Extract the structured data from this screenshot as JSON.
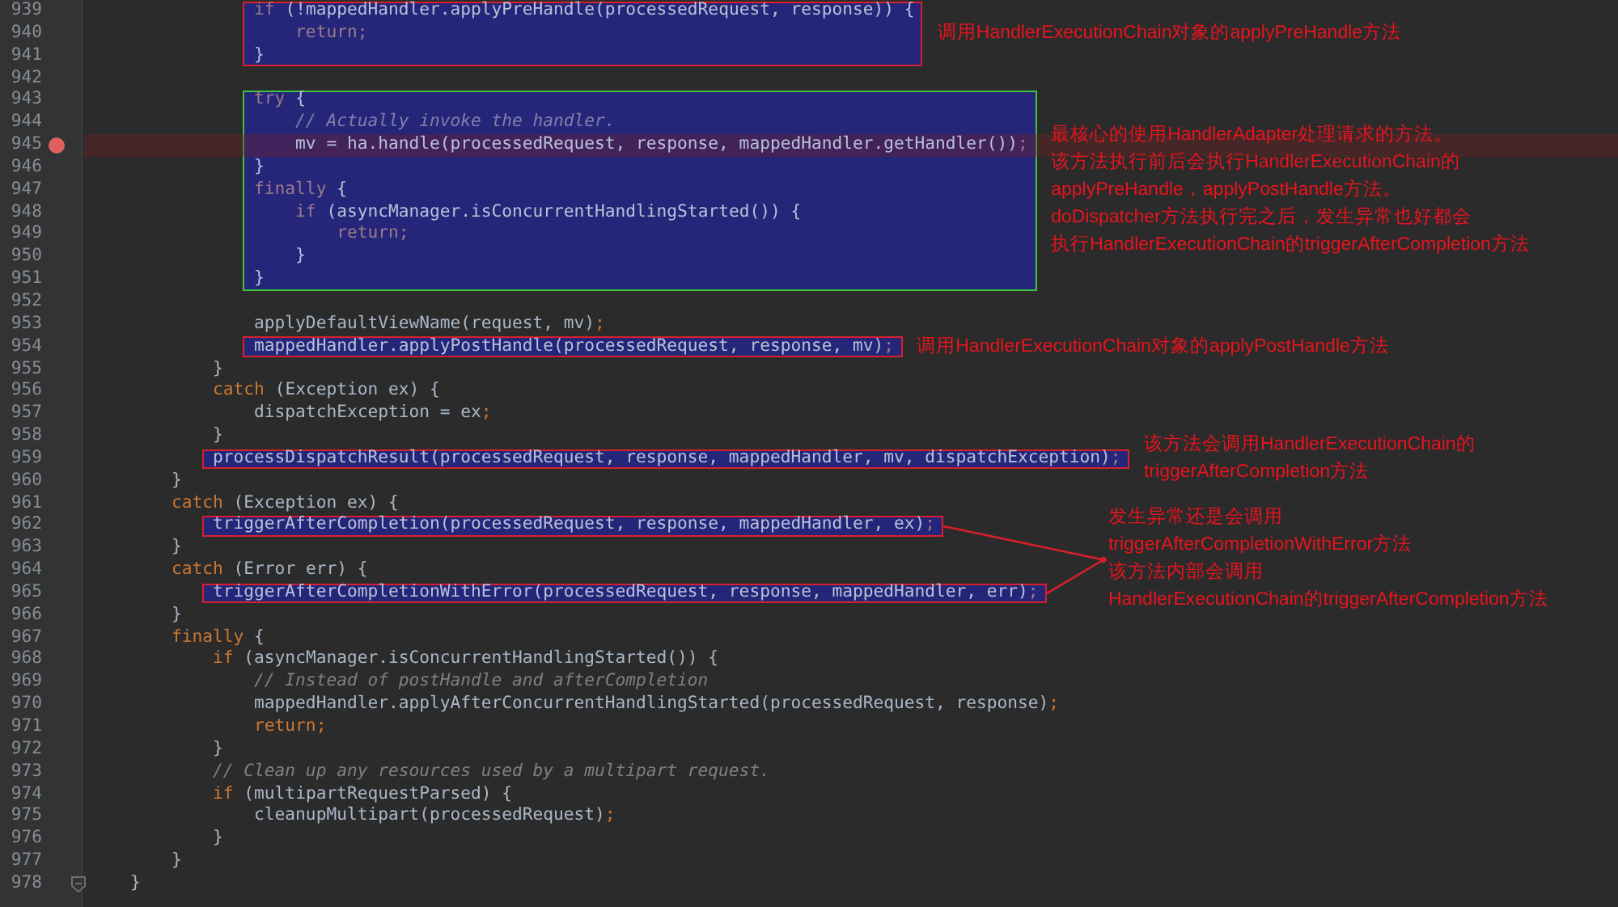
{
  "editor": {
    "segments": [
      {
        "kind": "highlight",
        "color": "#d8202c",
        "note": [
          "调用HandlerExecutionChain对象的applyPreHandle方法"
        ],
        "lines": [
          {
            "number": "939",
            "breakpoint": false,
            "fold": false,
            "tokens": [
              {
                "kind": "keyword",
                "text": "                if"
              },
              {
                "kind": "plain",
                "text": " (!mappedHandler.applyPreHandle(processedRequest, response)) {"
              }
            ]
          },
          {
            "number": "940",
            "breakpoint": false,
            "fold": false,
            "tokens": [
              {
                "kind": "keyword",
                "text": "                    return"
              },
              {
                "kind": "punct",
                "text": ";"
              }
            ]
          },
          {
            "number": "941",
            "breakpoint": false,
            "fold": false,
            "tokens": [
              {
                "kind": "plain",
                "text": "                }"
              }
            ]
          }
        ]
      },
      {
        "kind": "plain",
        "lines": [
          {
            "number": "942",
            "breakpoint": false,
            "fold": false
          }
        ]
      },
      {
        "kind": "highlight",
        "color": "#3cc43c",
        "note": [
          "最核心的使用HandlerAdapter处理请求的方法。",
          "该方法执行前后会执行HandlerExecutionChain的",
          "applyPreHandle，applyPostHandle方法。",
          "doDispatcher方法执行完之后，发生异常也好都会",
          "执行HandlerExecutionChain的triggerAfterCompletion方法"
        ],
        "lines": [
          {
            "number": "943",
            "breakpoint": false,
            "fold": false,
            "tokens": [
              {
                "kind": "keyword",
                "text": "                try"
              },
              {
                "kind": "plain",
                "text": " {"
              }
            ]
          },
          {
            "number": "944",
            "breakpoint": false,
            "fold": false,
            "tokens": [
              {
                "kind": "comment",
                "text": "                    // Actually invoke the handler."
              }
            ]
          },
          {
            "number": "945",
            "breakpoint": true,
            "fold": false,
            "tokens": [
              {
                "kind": "plain",
                "text": "                    mv = ha.handle(processedRequest, response, mappedHandler.getHandler())"
              },
              {
                "kind": "punct",
                "text": ";"
              }
            ]
          },
          {
            "number": "946",
            "breakpoint": false,
            "fold": false,
            "tokens": [
              {
                "kind": "plain",
                "text": "                }"
              }
            ]
          },
          {
            "number": "947",
            "breakpoint": false,
            "fold": false,
            "tokens": [
              {
                "kind": "keyword",
                "text": "                finally"
              },
              {
                "kind": "plain",
                "text": " {"
              }
            ]
          },
          {
            "number": "948",
            "breakpoint": false,
            "fold": false,
            "tokens": [
              {
                "kind": "keyword",
                "text": "                    if"
              },
              {
                "kind": "plain",
                "text": " (asyncManager.isConcurrentHandlingStarted()) {"
              }
            ]
          },
          {
            "number": "949",
            "breakpoint": false,
            "fold": false,
            "tokens": [
              {
                "kind": "keyword",
                "text": "                        return"
              },
              {
                "kind": "punct",
                "text": ";"
              }
            ]
          },
          {
            "number": "950",
            "breakpoint": false,
            "fold": false,
            "tokens": [
              {
                "kind": "plain",
                "text": "                    }"
              }
            ]
          },
          {
            "number": "951",
            "breakpoint": false,
            "fold": false,
            "tokens": [
              {
                "kind": "plain",
                "text": "                }"
              }
            ]
          }
        ]
      },
      {
        "kind": "plain",
        "lines": [
          {
            "number": "952",
            "breakpoint": false,
            "fold": false
          },
          {
            "number": "953",
            "breakpoint": false,
            "fold": false,
            "tokens": [
              {
                "kind": "plain",
                "text": "                applyDefaultViewName(request, mv)"
              },
              {
                "kind": "punct",
                "text": ";"
              }
            ]
          }
        ]
      },
      {
        "kind": "highlight",
        "color": "#d8202c",
        "note": [
          "调用HandlerExecutionChain对象的applyPostHandle方法"
        ],
        "lines": [
          {
            "number": "954",
            "breakpoint": false,
            "fold": false,
            "tokens": [
              {
                "kind": "plain",
                "text": "                mappedHandler.applyPostHandle(processedRequest, response, mv)"
              },
              {
                "kind": "punct",
                "text": ";"
              }
            ]
          }
        ]
      },
      {
        "kind": "plain",
        "lines": [
          {
            "number": "955",
            "breakpoint": false,
            "fold": false,
            "tokens": [
              {
                "kind": "plain",
                "text": "            }"
              }
            ]
          },
          {
            "number": "956",
            "breakpoint": false,
            "fold": false,
            "tokens": [
              {
                "kind": "keyword",
                "text": "            catch"
              },
              {
                "kind": "plain",
                "text": " (Exception ex) {"
              }
            ]
          },
          {
            "number": "957",
            "breakpoint": false,
            "fold": false,
            "tokens": [
              {
                "kind": "plain",
                "text": "                dispatchException = ex"
              },
              {
                "kind": "punct",
                "text": ";"
              }
            ]
          },
          {
            "number": "958",
            "breakpoint": false,
            "fold": false,
            "tokens": [
              {
                "kind": "plain",
                "text": "            }"
              }
            ]
          }
        ]
      },
      {
        "kind": "highlight",
        "color": "#d8202c",
        "note": [
          "该方法会调用HandlerExecutionChain的",
          "triggerAfterCompletion方法"
        ],
        "lines": [
          {
            "number": "959",
            "breakpoint": false,
            "fold": false,
            "tokens": [
              {
                "kind": "plain",
                "text": "            processDispatchResult(processedRequest, response, mappedHandler, mv, dispatchException)"
              },
              {
                "kind": "punct",
                "text": ";"
              }
            ]
          }
        ]
      },
      {
        "kind": "plain",
        "lines": [
          {
            "number": "960",
            "breakpoint": false,
            "fold": false,
            "tokens": [
              {
                "kind": "plain",
                "text": "        }"
              }
            ]
          },
          {
            "number": "961",
            "breakpoint": false,
            "fold": false,
            "tokens": [
              {
                "kind": "keyword",
                "text": "        catch"
              },
              {
                "kind": "plain",
                "text": " (Exception ex) {"
              }
            ]
          }
        ]
      },
      {
        "kind": "highlight",
        "color": "#d8202c",
        "lines": [
          {
            "number": "962",
            "breakpoint": false,
            "fold": false,
            "tokens": [
              {
                "kind": "plain",
                "text": "            triggerAfterCompletion(processedRequest, response, mappedHandler, ex)"
              },
              {
                "kind": "punct",
                "text": ";"
              }
            ]
          }
        ]
      },
      {
        "kind": "plain",
        "lines": [
          {
            "number": "963",
            "breakpoint": false,
            "fold": false,
            "tokens": [
              {
                "kind": "plain",
                "text": "        }"
              }
            ]
          },
          {
            "number": "964",
            "breakpoint": false,
            "fold": false,
            "tokens": [
              {
                "kind": "keyword",
                "text": "        catch"
              },
              {
                "kind": "plain",
                "text": " (Error err) {"
              }
            ]
          }
        ]
      },
      {
        "kind": "highlight",
        "color": "#d8202c",
        "lines": [
          {
            "number": "965",
            "breakpoint": false,
            "fold": false,
            "tokens": [
              {
                "kind": "plain",
                "text": "            triggerAfterCompletionWithError(processedRequest, response, mappedHandler, err)"
              },
              {
                "kind": "punct",
                "text": ";"
              }
            ]
          }
        ]
      },
      {
        "kind": "plain",
        "lines": [
          {
            "number": "966",
            "breakpoint": false,
            "fold": false,
            "tokens": [
              {
                "kind": "plain",
                "text": "        }"
              }
            ]
          },
          {
            "number": "967",
            "breakpoint": false,
            "fold": false,
            "tokens": [
              {
                "kind": "keyword",
                "text": "        finally"
              },
              {
                "kind": "plain",
                "text": " {"
              }
            ]
          },
          {
            "number": "968",
            "breakpoint": false,
            "fold": false,
            "tokens": [
              {
                "kind": "keyword",
                "text": "            if"
              },
              {
                "kind": "plain",
                "text": " (asyncManager.isConcurrentHandlingStarted()) {"
              }
            ]
          },
          {
            "number": "969",
            "breakpoint": false,
            "fold": false,
            "tokens": [
              {
                "kind": "comment",
                "text": "                // Instead of postHandle and afterCompletion"
              }
            ]
          },
          {
            "number": "970",
            "breakpoint": false,
            "fold": false,
            "tokens": [
              {
                "kind": "plain",
                "text": "                mappedHandler.applyAfterConcurrentHandlingStarted(processedRequest, response)"
              },
              {
                "kind": "punct",
                "text": ";"
              }
            ]
          },
          {
            "number": "971",
            "breakpoint": false,
            "fold": false,
            "tokens": [
              {
                "kind": "keyword",
                "text": "                return"
              },
              {
                "kind": "punct",
                "text": ";"
              }
            ]
          },
          {
            "number": "972",
            "breakpoint": false,
            "fold": false,
            "tokens": [
              {
                "kind": "plain",
                "text": "            }"
              }
            ]
          },
          {
            "number": "973",
            "breakpoint": false,
            "fold": false,
            "tokens": [
              {
                "kind": "comment",
                "text": "            // Clean up any resources used by a multipart request."
              }
            ]
          },
          {
            "number": "974",
            "breakpoint": false,
            "fold": false,
            "tokens": [
              {
                "kind": "keyword",
                "text": "            if"
              },
              {
                "kind": "plain",
                "text": " (multipartRequestParsed) {"
              }
            ]
          },
          {
            "number": "975",
            "breakpoint": false,
            "fold": false,
            "tokens": [
              {
                "kind": "plain",
                "text": "                cleanupMultipart(processedRequest)"
              },
              {
                "kind": "punct",
                "text": ";"
              }
            ]
          },
          {
            "number": "976",
            "breakpoint": false,
            "fold": false,
            "tokens": [
              {
                "kind": "plain",
                "text": "            }"
              }
            ]
          },
          {
            "number": "977",
            "breakpoint": false,
            "fold": false,
            "tokens": [
              {
                "kind": "plain",
                "text": "        }"
              }
            ]
          },
          {
            "number": "978",
            "breakpoint": false,
            "fold": true,
            "tokens": [
              {
                "kind": "plain",
                "text": "    }"
              }
            ]
          }
        ]
      }
    ],
    "shared_note": [
      "发生异常还是会调用",
      "triggerAfterCompletionWithError方法",
      "该方法内部会调用",
      "HandlerExecutionChain的triggerAfterCompletion方法"
    ]
  }
}
